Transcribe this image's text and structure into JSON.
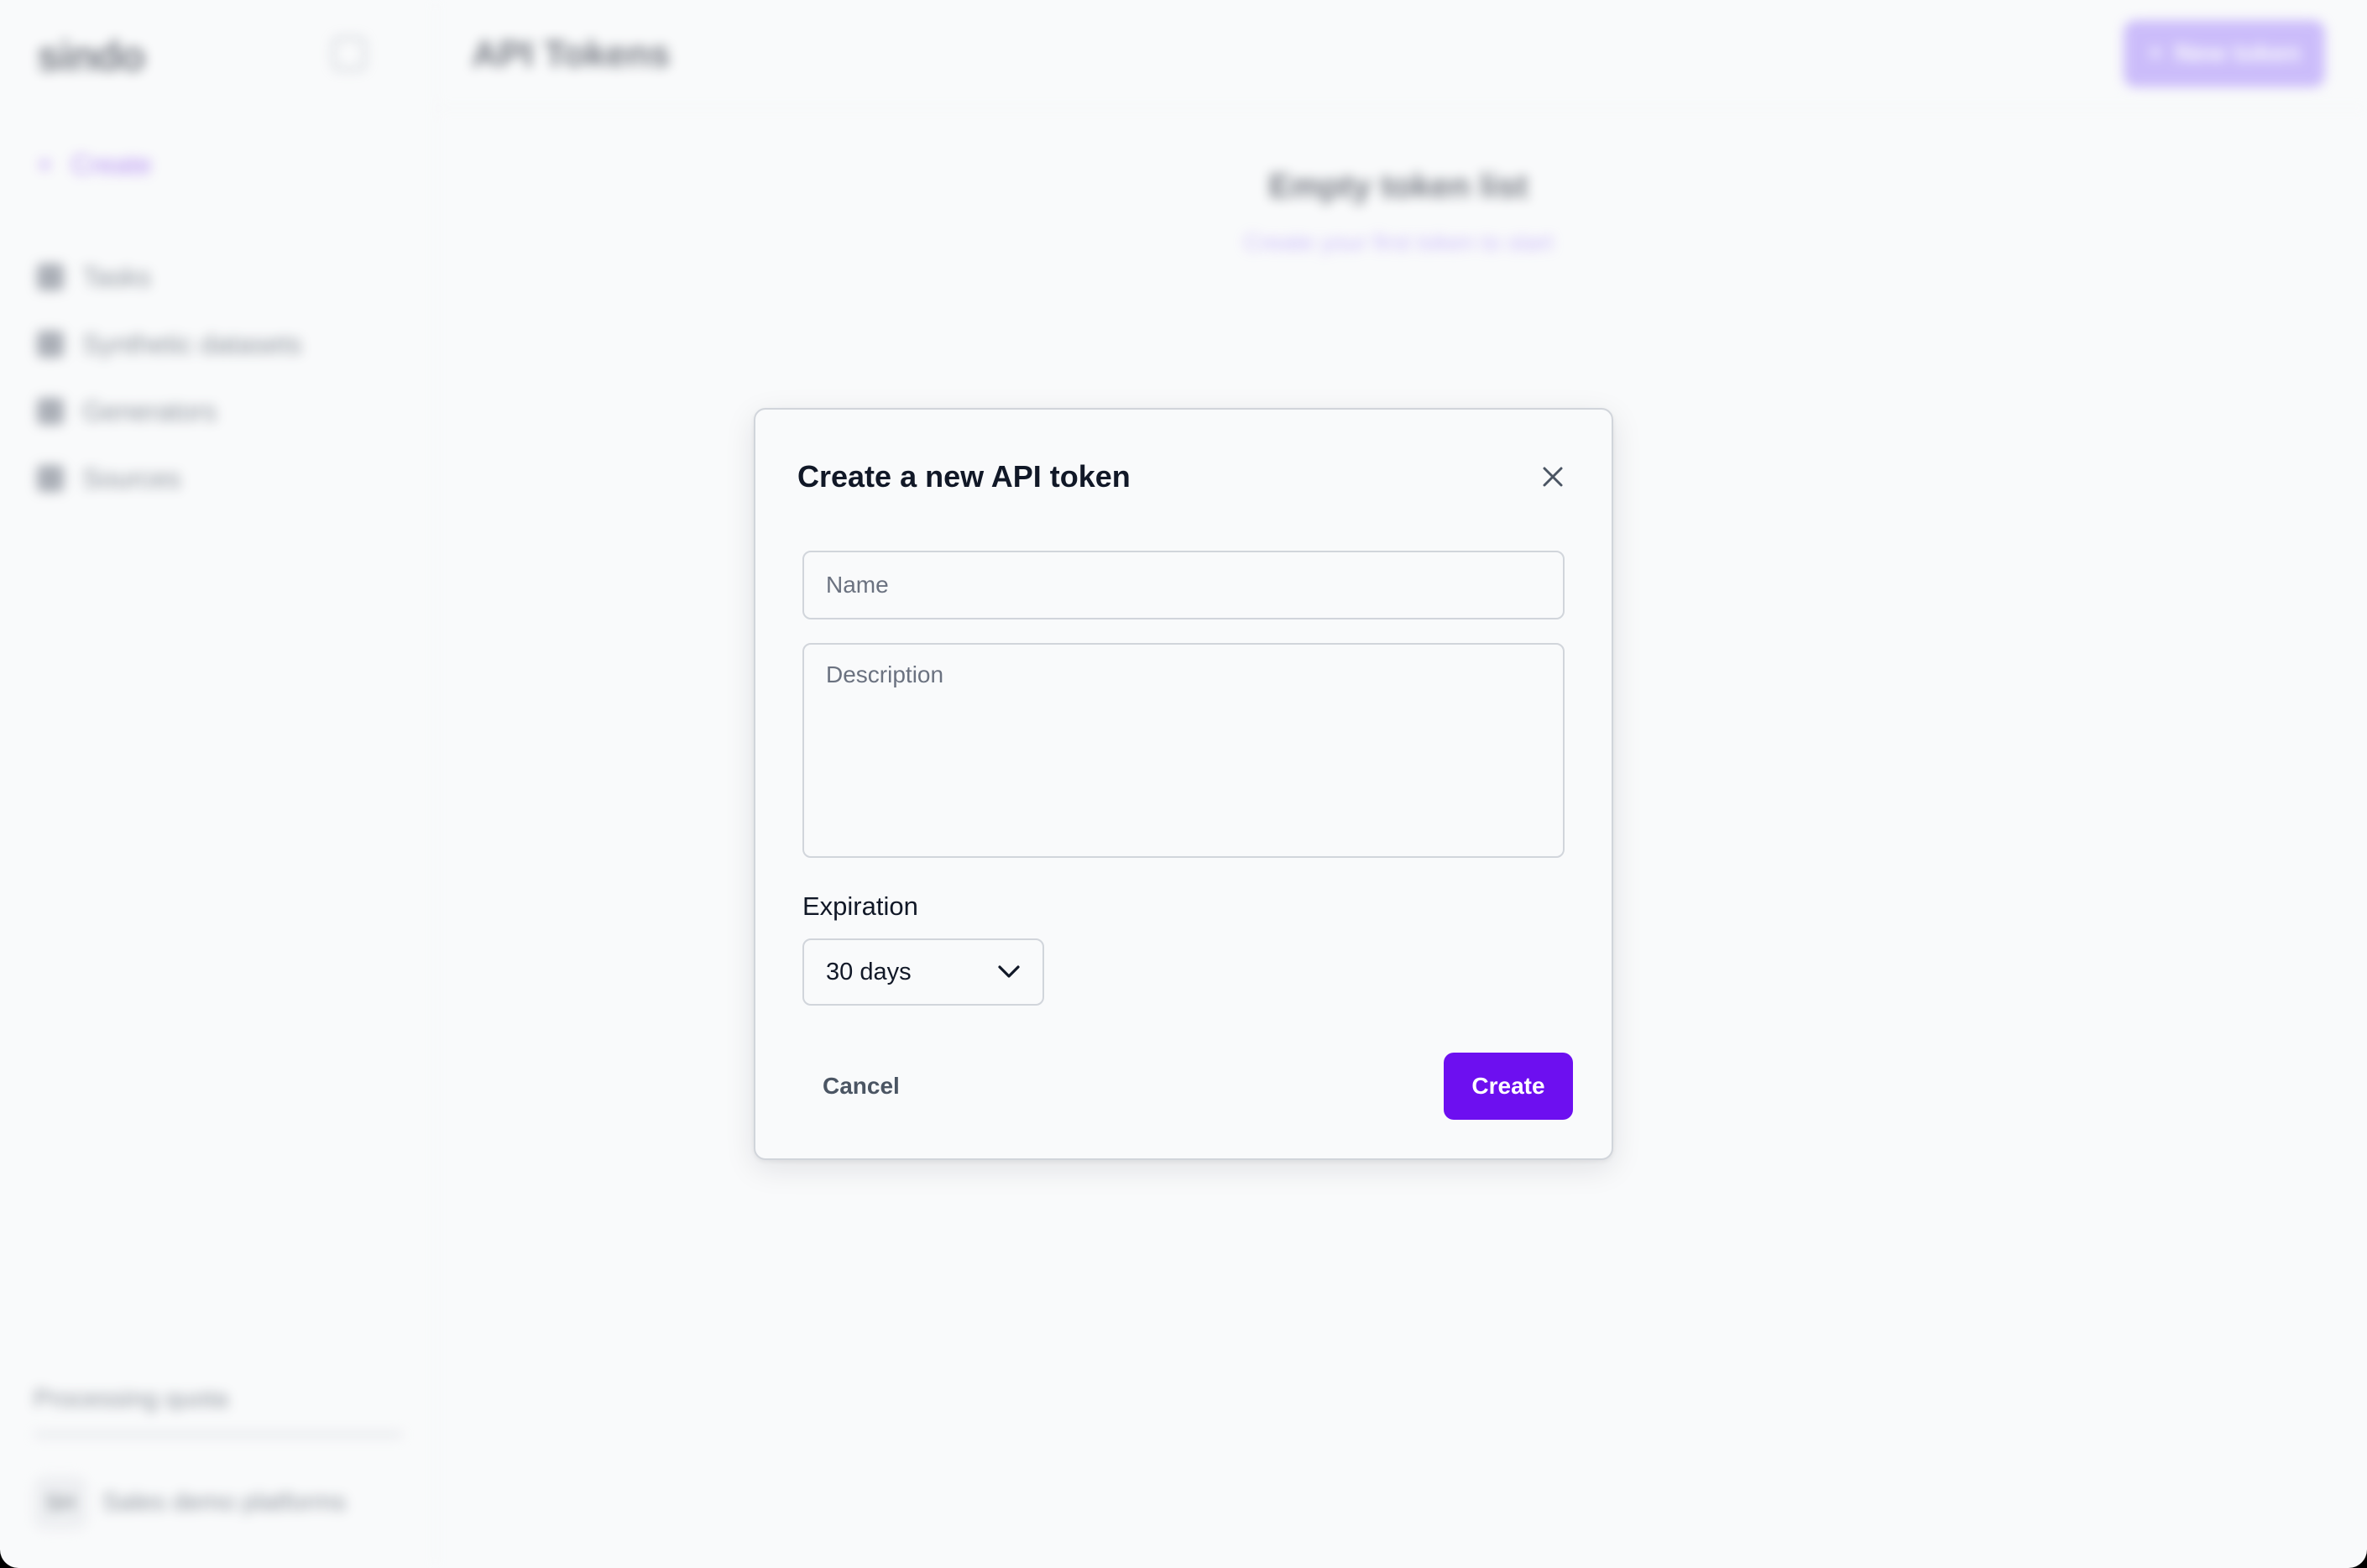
{
  "colors": {
    "background": "#f9fafb",
    "accent": "#6d0ff0",
    "accent_light": "#a78bfa",
    "text_primary": "#111827",
    "text_muted": "#6b7280",
    "border": "#d1d5db"
  },
  "background_app": {
    "logo": "sindo",
    "create_label": "Create",
    "nav": [
      {
        "label": "Tasks",
        "icon": "tasks-icon"
      },
      {
        "label": "Synthetic datasets",
        "icon": "dataset-icon"
      },
      {
        "label": "Generators",
        "icon": "generator-icon"
      },
      {
        "label": "Sources",
        "icon": "sources-icon"
      }
    ],
    "credits_label": "Processing quota",
    "user_initials": "SH",
    "user_name": "Sales demo platforms",
    "page_title": "API Tokens",
    "new_token_label": "New token",
    "empty_title": "Empty token list",
    "empty_subtitle": "Create your first token to start"
  },
  "modal": {
    "title": "Create a new API token",
    "close_icon": "close-icon",
    "name_placeholder": "Name",
    "description_placeholder": "Description",
    "expiration_label": "Expiration",
    "expiration_value": "30 days",
    "expiration_icon": "chevron-down-icon",
    "cancel_label": "Cancel",
    "create_label": "Create"
  }
}
